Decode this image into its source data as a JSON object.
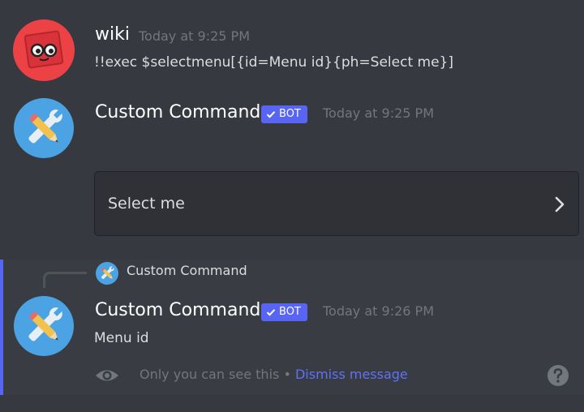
{
  "messages": [
    {
      "author": "wiki",
      "timestamp": "Today at 9:25 PM",
      "content": "!!exec $selectmenu[{id=Menu id}{ph=Select me}]",
      "avatar_icon": "wiki-avatar-icon"
    },
    {
      "author": "Custom Command",
      "bot_tag": "BOT",
      "timestamp": "Today at 9:25 PM",
      "avatar_icon": "pencil-wrench-icon",
      "select_menu": {
        "placeholder": "Select me",
        "icon": "chevron-right-icon"
      }
    },
    {
      "reply_to": "Custom Command",
      "author": "Custom Command",
      "bot_tag": "BOT",
      "timestamp": "Today at 9:26 PM",
      "content": "Menu id",
      "avatar_icon": "pencil-wrench-icon",
      "ephemeral_note": "Only you can see this",
      "separator": " • ",
      "dismiss_label": "Dismiss message"
    }
  ],
  "colors": {
    "background": "#36393f",
    "ephemeral_background": "#393c43",
    "accent": "#5865f2",
    "link": "#5d73f5",
    "timestamp": "#72767d"
  }
}
